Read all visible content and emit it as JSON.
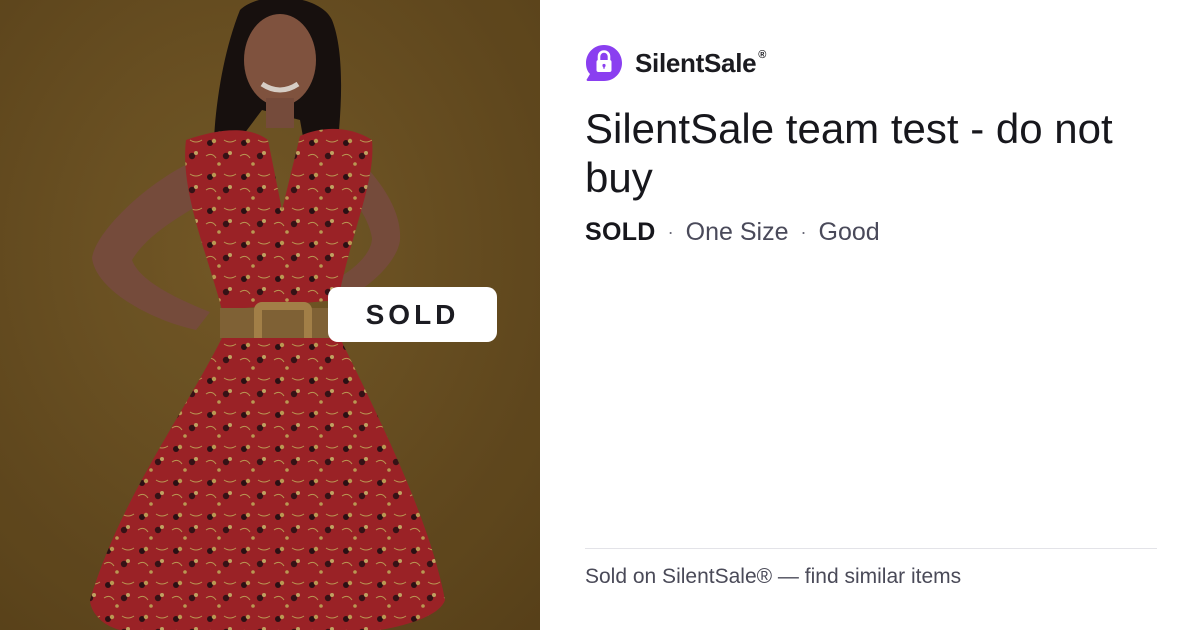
{
  "product": {
    "image_alt": "Woman wearing a red floral dress with a woven belt",
    "sold_badge": "SOLD",
    "title": "SilentSale team test - do not buy",
    "status": "SOLD",
    "separator": "·",
    "size": "One Size",
    "condition": "Good"
  },
  "brand": {
    "name": "SilentSale",
    "registered_mark": "®",
    "logo_icon": "padlock-chat-bubble-icon",
    "accent_color": "#8a3ff0"
  },
  "footer": {
    "text": "Sold on SilentSale® — find similar items"
  }
}
